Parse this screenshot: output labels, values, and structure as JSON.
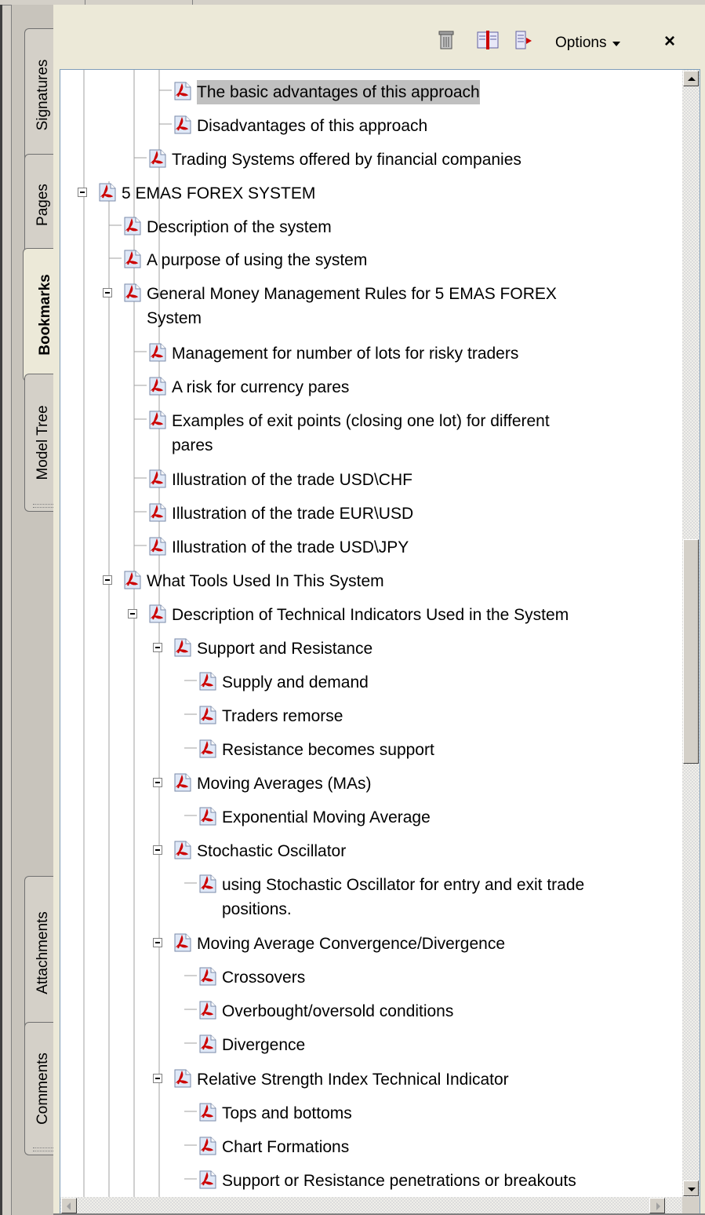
{
  "side_tabs": [
    {
      "label": "Signatures",
      "active": false
    },
    {
      "label": "Pages",
      "active": false
    },
    {
      "label": "Bookmarks",
      "active": true
    },
    {
      "label": "Model Tree",
      "active": false
    },
    {
      "label": "Attachments",
      "active": false
    },
    {
      "label": "Comments",
      "active": false
    }
  ],
  "toolbar": {
    "delete_icon": "trash-icon",
    "new_bookmark_icon": "new-bookmark-icon",
    "expand_icon": "expand-bookmark-icon",
    "options_label": "Options",
    "close_label": "×"
  },
  "bookmarks": [
    {
      "text": "The basic advantages of this approach",
      "level": 2,
      "highlighted": true
    },
    {
      "text": "Disadvantages of this approach",
      "level": 2
    },
    {
      "text": "Trading Systems offered by financial companies",
      "level": 1
    },
    {
      "text": "5 EMAS FOREX SYSTEM",
      "level": -1,
      "expanded": true
    },
    {
      "text": "Description of the system",
      "level": 0
    },
    {
      "text": "A purpose of using the system",
      "level": 0
    },
    {
      "text": "General Money Management Rules for 5 EMAS FOREX",
      "cont": "System",
      "level": 0,
      "expanded": true
    },
    {
      "text": "Management for number of lots for risky traders",
      "level": 1
    },
    {
      "text": "A risk for currency pares",
      "level": 1
    },
    {
      "text": "Examples of exit points (closing one lot) for different",
      "cont": "pares",
      "level": 1
    },
    {
      "text": "Illustration of the trade USD\\CHF",
      "level": 1
    },
    {
      "text": "Illustration of the trade EUR\\USD",
      "level": 1
    },
    {
      "text": "Illustration of the trade USD\\JPY",
      "level": 1
    },
    {
      "text": "What Tools Used In This System",
      "level": 0,
      "expanded": true
    },
    {
      "text": "Description of Technical Indicators Used in the System",
      "level": 1,
      "expanded": true
    },
    {
      "text": "Support and Resistance",
      "level": 2,
      "expanded": true
    },
    {
      "text": "Supply and demand",
      "level": 3
    },
    {
      "text": "Traders remorse",
      "level": 3
    },
    {
      "text": "Resistance becomes support",
      "level": 3
    },
    {
      "text": "Moving Averages (MAs)",
      "level": 2,
      "expanded": true
    },
    {
      "text": "Exponential Moving Average",
      "level": 3
    },
    {
      "text": "Stochastic Oscillator",
      "level": 2,
      "expanded": true
    },
    {
      "text": "using Stochastic Oscillator for entry and exit trade",
      "cont": "positions.",
      "level": 3
    },
    {
      "text": "Moving Average Convergence/Divergence",
      "level": 2,
      "expanded": true
    },
    {
      "text": "Crossovers",
      "level": 3
    },
    {
      "text": "Overbought/oversold conditions",
      "level": 3
    },
    {
      "text": "Divergence",
      "level": 3
    },
    {
      "text": "Relative Strength Index Technical Indicator",
      "level": 2,
      "expanded": true
    },
    {
      "text": "Tops and bottoms",
      "level": 3
    },
    {
      "text": "Chart Formations",
      "level": 3
    },
    {
      "text": "Support or Resistance penetrations or breakouts",
      "level": 3
    }
  ],
  "colors": {
    "pdf_icon_red": "#cc0000",
    "highlight": "#c0c0c0",
    "tree_line": "#a0a0a0"
  }
}
